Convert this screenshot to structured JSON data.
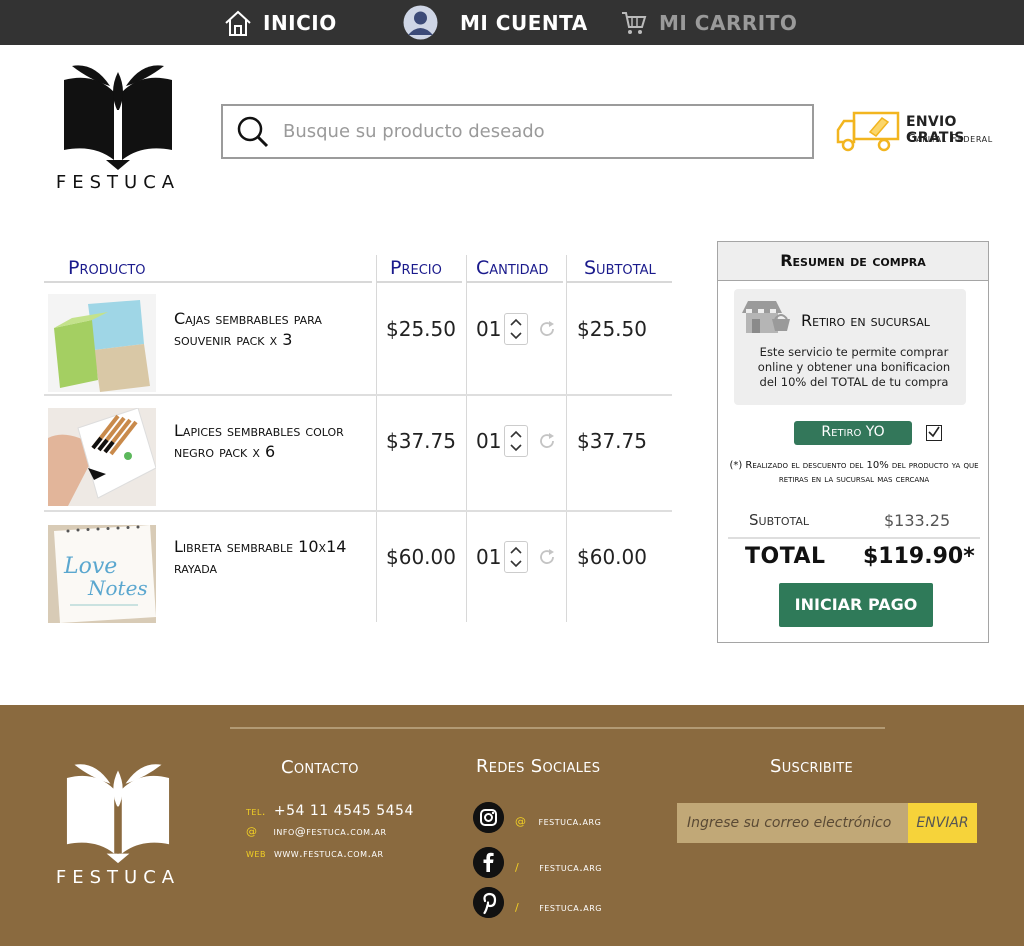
{
  "nav": {
    "home_label": "INICIO",
    "account_label": "MI CUENTA",
    "cart_label": "MI CARRITO"
  },
  "brand": {
    "name": "FESTUCA"
  },
  "search": {
    "placeholder": "Busque su producto deseado"
  },
  "shipping": {
    "title": "ENVIO GRATIS",
    "subtitle": "Capital Federal"
  },
  "table": {
    "headers": {
      "product": "Producto",
      "price": "Precio",
      "quantity": "Cantidad",
      "subtotal": "Subtotal"
    },
    "rows": [
      {
        "name": "Cajas sembrables para souvenir pack x 3",
        "price": "$25.50",
        "qty": "01",
        "subtotal": "$25.50",
        "image": "green-and-kraft-boxes"
      },
      {
        "name": "Lapices sembrables color negro pack x 6",
        "price": "$37.75",
        "qty": "01",
        "subtotal": "$37.75",
        "image": "pencil-pack"
      },
      {
        "name": "Libreta sembrable 10x14 rayada",
        "price": "$60.00",
        "qty": "01",
        "subtotal": "$60.00",
        "image": "love-notes-notebook"
      }
    ]
  },
  "summary": {
    "title": "Resumen de compra",
    "pickup_title": "Retiro en sucursal",
    "pickup_desc": "Este servicio te permite comprar online y obtener una bonificacion del 10% del TOTAL de tu compra",
    "pickup_button": "Retiro YO",
    "pickup_checked": true,
    "note": "(*) Realizado el descuento del 10% del producto ya que retiras en la sucursal mas cercana",
    "subtotal_label": "Subtotal",
    "subtotal_value": "$133.25",
    "total_label": "TOTAL",
    "total_value": "$119.90*",
    "pay_button": "INICIAR PAGO"
  },
  "footer": {
    "contact": {
      "title": "Contacto",
      "tel_key": "tel.",
      "tel": "+54 11 4545 5454",
      "email_key": "@",
      "email": "info@festuca.com.ar",
      "web_key": "web",
      "web": "www.festuca.com.ar"
    },
    "social": {
      "title": "Redes Sociales",
      "items": [
        {
          "icon": "instagram-icon",
          "sep": "@",
          "handle": "festuca.arg"
        },
        {
          "icon": "facebook-icon",
          "sep": "/",
          "handle": "festuca.arg"
        },
        {
          "icon": "pinterest-icon",
          "sep": "/",
          "handle": "festuca.arg"
        }
      ]
    },
    "subscribe": {
      "title": "Suscribite",
      "placeholder": "Ingrese su correo electrónico",
      "button": "ENVIAR"
    }
  },
  "colors": {
    "topbar": "#333333",
    "header_text": "#1a1a8c",
    "accent_green": "#2f7a59",
    "footer_bg": "#8a6a3f",
    "footer_accent": "#f6d33a"
  }
}
